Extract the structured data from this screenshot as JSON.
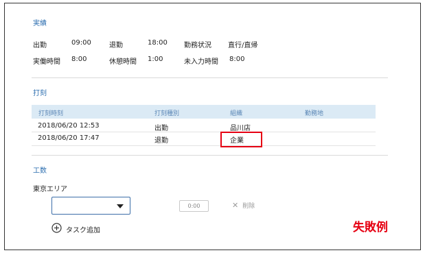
{
  "results": {
    "title": "実績",
    "row1": [
      {
        "label": "出勤",
        "value": "09:00"
      },
      {
        "label": "退勤",
        "value": "18:00"
      },
      {
        "label": "勤務状況",
        "value": "直行/直帰"
      }
    ],
    "row2": [
      {
        "label": "実働時間",
        "value": "8:00"
      },
      {
        "label": "休憩時間",
        "value": "1:00"
      },
      {
        "label": "未入力時間",
        "value": "8:00"
      }
    ]
  },
  "stamps": {
    "title": "打刻",
    "columns": [
      "打刻時刻",
      "打刻種別",
      "組織",
      "勤務地"
    ],
    "rows": [
      {
        "time": "2018/06/20 12:53",
        "type": "出勤",
        "org": "品川店",
        "location": ""
      },
      {
        "time": "2018/06/20 17:47",
        "type": "退勤",
        "org": "企業",
        "location": ""
      }
    ]
  },
  "manhours": {
    "title": "工数",
    "area": "東京エリア",
    "select_value": "",
    "time_value": "0:00",
    "delete_label": "削除",
    "add_task_label": "タスク追加"
  },
  "annotation": {
    "label": "失敗例",
    "color": "#e60012"
  },
  "colors": {
    "accent": "#2e6fb0",
    "table_header_bg": "#dbeaf5",
    "highlight_border": "#e60012"
  }
}
